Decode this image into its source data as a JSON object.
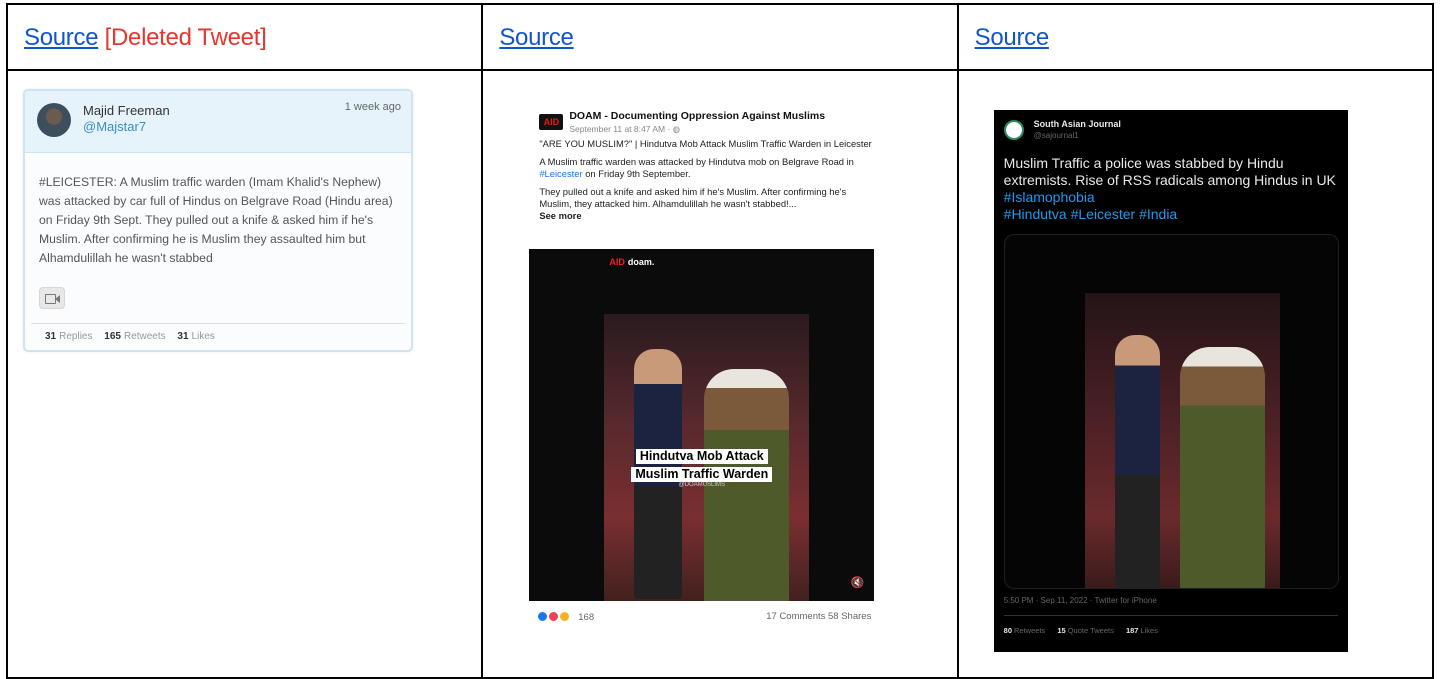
{
  "columns": [
    {
      "source_label": "Source",
      "deleted_label": "[Deleted Tweet]"
    },
    {
      "source_label": "Source"
    },
    {
      "source_label": "Source"
    }
  ],
  "card1": {
    "name": "Majid Freeman",
    "handle": "@Majstar7",
    "time": "1 week ago",
    "text": "#LEICESTER: A Muslim traffic warden (Imam Khalid's Nephew) was attacked by car full of Hindus on Belgrave Road (Hindu area) on Friday 9th Sept. They pulled out a knife & asked him if he's Muslim. After confirming he is Muslim they assaulted him but Alhamdulillah he wasn't stabbed",
    "video_icon": "video-camera-icon",
    "stats": {
      "replies_count": "31",
      "replies_label": "Replies",
      "retweets_count": "165",
      "retweets_label": "Retweets",
      "likes_count": "31",
      "likes_label": "Likes"
    }
  },
  "card2": {
    "page_name": "DOAM - Documenting Oppression Against Muslims",
    "logo_text": "AID",
    "date": "September 11 at 8:47 AM · ",
    "para1": "\"ARE YOU MUSLIM?\" | Hindutva Mob Attack Muslim Traffic Warden in Leicester",
    "para2_a": "A Muslim traffic warden was attacked by Hindutva mob on Belgrave Road in ",
    "para2_link": "#Leicester",
    "para2_b": " on Friday 9th September.",
    "para3": "They pulled out a knife and asked him if he's Muslim. After confirming he's Muslim, they attacked him. Alhamdulillah he wasn't stabbed!...",
    "see_more": "See more",
    "video_brand": "doam.",
    "video_brand_logo": "AID",
    "caption_line1": "Hindutva Mob Attack",
    "caption_line2": "Muslim Traffic Warden",
    "video_social": "@DOAMUSLIMS",
    "reaction_count": "168",
    "comments_shares": "17 Comments  58 Shares"
  },
  "card3": {
    "name": "South Asian Journal",
    "handle": "@sajournal1",
    "text": "Muslim Traffic a police was stabbed by Hindu extremists. Rise of RSS radicals among Hindus in UK",
    "tag1": "#Islamophobia",
    "tags2": "#Hindutva #Leicester #India",
    "time": "5:50 PM · Sep 11, 2022 · Twitter for iPhone",
    "stats": {
      "retweets_count": "80",
      "retweets_label": "Retweets",
      "quotes_count": "15",
      "quotes_label": "Quote Tweets",
      "likes_count": "187",
      "likes_label": "Likes"
    }
  },
  "colors": {
    "link": "#1155cc",
    "deleted": "#e8352d",
    "twitter_blue": "#1d9bf0",
    "facebook_blue": "#1877f2"
  }
}
